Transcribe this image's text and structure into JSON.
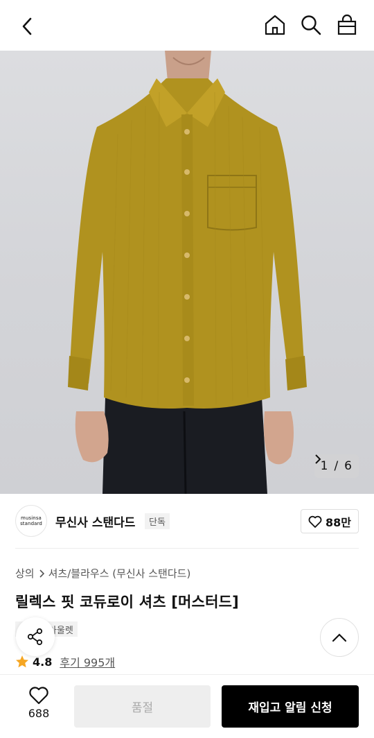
{
  "header": {
    "back_icon": "chevron-left-icon",
    "icons": [
      "home-icon",
      "search-icon",
      "shopping-bag-icon"
    ]
  },
  "gallery": {
    "current": "1",
    "separator": "/",
    "total": "6"
  },
  "brand": {
    "logo_line1": "musinsa",
    "logo_line2": "standard",
    "name": "무신사 스탠다드",
    "badge": "단독",
    "like_count": "88만"
  },
  "product": {
    "breadcrumbs": [
      "상의",
      "셔츠/블라우스 (무신사 스탠다드)"
    ],
    "title": "릴렉스 핏 코듀로이 셔츠 [머스터드]",
    "tags": [
      "단독",
      "아울렛"
    ],
    "rating": "4.8",
    "reviews": "후기 995개"
  },
  "bottom": {
    "wish_count": "688",
    "soldout_label": "품절",
    "restock_label": "재입고 알림 신청"
  },
  "colors": {
    "shirt": "#B0921F",
    "restock_button": "#000000",
    "star": "#F5A623"
  }
}
